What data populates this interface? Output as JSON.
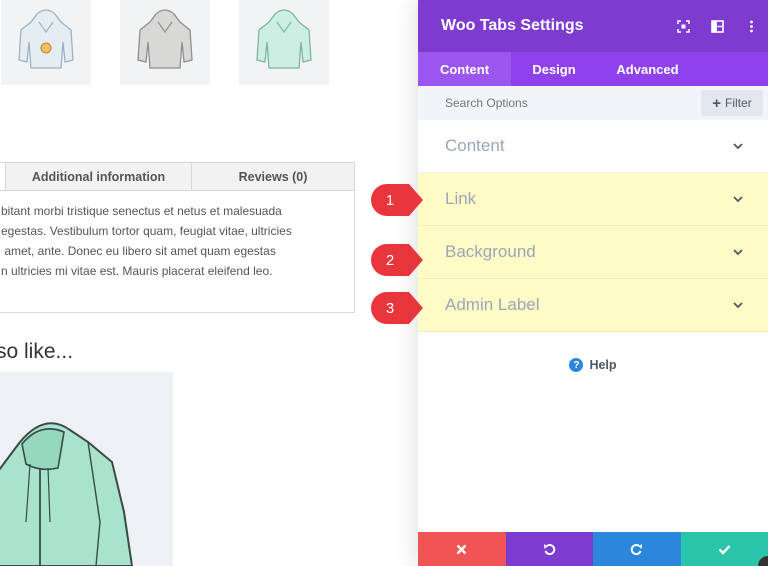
{
  "page": {
    "tabs": [
      "Additional information",
      "Reviews (0)"
    ],
    "description_lines": [
      "bitant morbi tristique senectus et netus et malesuada",
      "egestas. Vestibulum tortor quam, feugiat vitae, ultricies",
      " amet, ante. Donec eu libero sit amet quam egestas",
      "n ultricies mi vitae est. Mauris placerat eleifend leo."
    ],
    "also_like": "so like..."
  },
  "panel": {
    "title": "Woo Tabs Settings",
    "tabs": [
      {
        "label": "Content",
        "active": true
      },
      {
        "label": "Design",
        "active": false
      },
      {
        "label": "Advanced",
        "active": false
      }
    ],
    "search_placeholder": "Search Options",
    "filter_label": "Filter",
    "toggles": [
      {
        "title": "Content",
        "highlighted": false
      },
      {
        "title": "Link",
        "highlighted": true
      },
      {
        "title": "Background",
        "highlighted": true
      },
      {
        "title": "Admin Label",
        "highlighted": true
      }
    ],
    "help_label": "Help",
    "header_icons": [
      "focus-icon",
      "split-layout-icon",
      "kebab-menu-icon"
    ],
    "footer_buttons": [
      {
        "name": "discard",
        "icon": "close-icon",
        "color": "#ef5555"
      },
      {
        "name": "undo",
        "icon": "undo-icon",
        "color": "#7e3bd0"
      },
      {
        "name": "redo",
        "icon": "redo-icon",
        "color": "#2b87da"
      },
      {
        "name": "save",
        "icon": "check-icon",
        "color": "#29c4a9"
      }
    ]
  },
  "callouts": [
    "1",
    "2",
    "3"
  ],
  "colors": {
    "header": "#7e3bd0",
    "tabs_bar": "#8f42ec",
    "highlight": "#fffbc6",
    "callout": "#e8363c"
  }
}
